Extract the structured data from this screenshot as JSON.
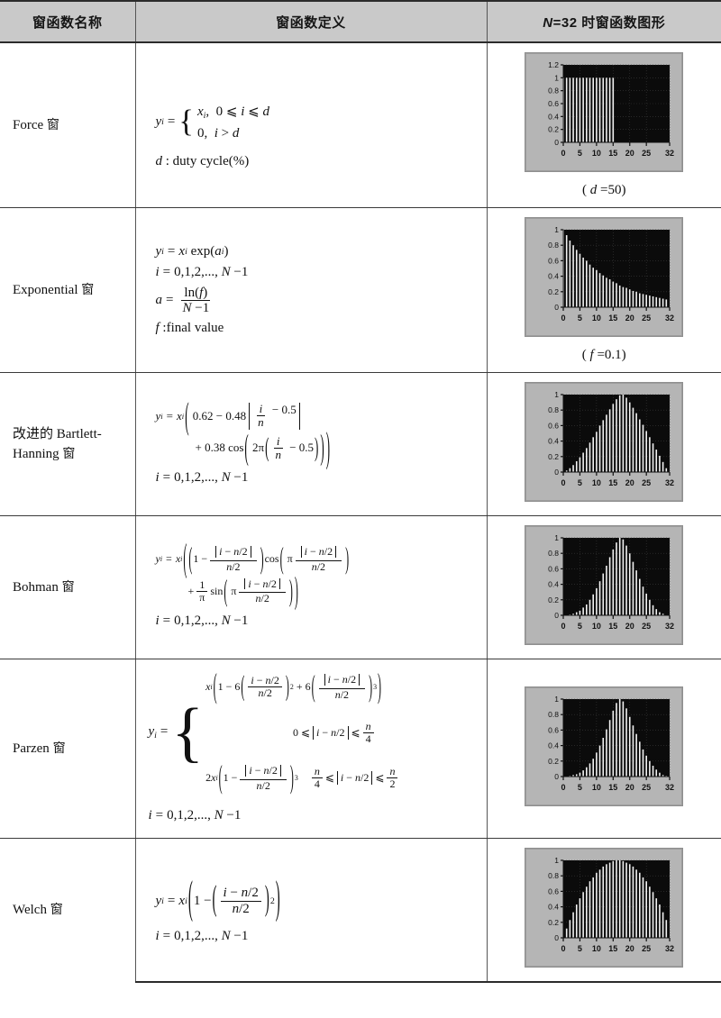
{
  "table": {
    "headers": {
      "name": "窗函数名称",
      "definition": "窗函数定义",
      "plot_prefix": "N",
      "plot_rest": "=32 时窗函数图形"
    },
    "rows": [
      {
        "id": "force",
        "name_en": "Force",
        "name_cn": "窗",
        "caption_open": "(",
        "caption_var": "d",
        "caption_val": "=50)",
        "formula_lines": [
          "y_i = { x_i, 0 ≤ i ≤ d ; 0, i > d }",
          "d : duty cycle(%)"
        ],
        "tokens": {
          "y": "y",
          "eq": "=",
          "x": "x",
          "case1_cond": "0 ≤ i ≤ d",
          "case1_val": "x",
          "case2_val": "0,",
          "case2_cond": "i > d",
          "note": "d : duty cycle(%)",
          "note_var": "d",
          "note_rest": ": duty cycle(%)"
        }
      },
      {
        "id": "exponential",
        "name_en": "Exponential",
        "name_cn": "窗",
        "caption_open": "(",
        "caption_var": "f",
        "caption_val": "=0.1)",
        "tokens": {
          "line1": "y_i = x_i exp(a_i)",
          "line2": "i = 0,1,2,..., N −1",
          "line3_a": "a",
          "line3_num": "ln(f)",
          "line3_den": "N −1",
          "line4_var": "f",
          "line4_rest": ":final value"
        }
      },
      {
        "id": "bartlett-hanning",
        "name_en": "改进的 Bartlett-Hanning",
        "name_cn": "窗",
        "caption_open": "",
        "caption_var": "",
        "caption_val": "",
        "tokens": {
          "c1": "0.62",
          "c2": "0.48",
          "c3": "0.5",
          "c4": "0.38",
          "c5": "2π",
          "c6": "0.5",
          "index": "i = 0,1,2,..., N −1"
        }
      },
      {
        "id": "bohman",
        "name_en": "Bohman",
        "name_cn": "窗",
        "caption_open": "",
        "caption_var": "",
        "caption_val": "",
        "tokens": {
          "one": "1",
          "absnum": "|i − n/2|",
          "den": "n/2",
          "cos": "cos",
          "pi": "π",
          "sin": "sin",
          "index": "i = 0,1,2,..., N −1"
        }
      },
      {
        "id": "parzen",
        "name_en": "Parzen",
        "name_cn": "窗",
        "caption_open": "",
        "caption_var": "",
        "caption_val": "",
        "tokens": {
          "coef6a": "6",
          "coef6b": "6",
          "pow2": "2",
          "pow3": "3",
          "cond1": "0 ≤ |i − n/2| ≤ n/4",
          "coef2": "2",
          "cond2": "n/4 ≤ |i − n/2| ≤ n/2",
          "index": "i = 0,1,2,..., N −1"
        }
      },
      {
        "id": "welch",
        "name_en": "Welch",
        "name_cn": "窗",
        "caption_open": "",
        "caption_var": "",
        "caption_val": "",
        "tokens": {
          "one": "1",
          "num": "i − n/2",
          "den": "n/2",
          "pow2": "2",
          "index": "i = 0,1,2,..., N −1"
        }
      }
    ]
  },
  "chart_data": [
    {
      "type": "bar",
      "id": "force-plot",
      "title": "",
      "xlabel": "",
      "ylabel": "",
      "xticks": [
        0,
        5,
        10,
        15,
        20,
        25,
        32
      ],
      "yticks": [
        "0",
        "0.2",
        "0.4",
        "0.6",
        "0.8",
        "1",
        "1.2"
      ],
      "ylim": [
        0,
        1.2
      ],
      "xlim": [
        0,
        32
      ],
      "x": [
        0,
        1,
        2,
        3,
        4,
        5,
        6,
        7,
        8,
        9,
        10,
        11,
        12,
        13,
        14,
        15,
        16,
        17,
        18,
        19,
        20,
        21,
        22,
        23,
        24,
        25,
        26,
        27,
        28,
        29,
        30,
        31
      ],
      "values": [
        1,
        1,
        1,
        1,
        1,
        1,
        1,
        1,
        1,
        1,
        1,
        1,
        1,
        1,
        1,
        1,
        0,
        0,
        0,
        0,
        0,
        0,
        0,
        0,
        0,
        0,
        0,
        0,
        0,
        0,
        0,
        0
      ],
      "bg": "#0b0b0b",
      "bar_color": "#f2f2f2",
      "panel": "#b5b5b5"
    },
    {
      "type": "bar",
      "id": "exponential-plot",
      "title": "",
      "xticks": [
        0,
        5,
        10,
        15,
        20,
        25,
        32
      ],
      "yticks": [
        "0",
        "0.2",
        "0.4",
        "0.6",
        "0.8",
        "1"
      ],
      "ylim": [
        0,
        1
      ],
      "xlim": [
        0,
        32
      ],
      "x": [
        0,
        1,
        2,
        3,
        4,
        5,
        6,
        7,
        8,
        9,
        10,
        11,
        12,
        13,
        14,
        15,
        16,
        17,
        18,
        19,
        20,
        21,
        22,
        23,
        24,
        25,
        26,
        27,
        28,
        29,
        30,
        31
      ],
      "values": [
        1.0,
        0.93,
        0.86,
        0.8,
        0.74,
        0.69,
        0.64,
        0.6,
        0.55,
        0.51,
        0.48,
        0.44,
        0.41,
        0.38,
        0.36,
        0.33,
        0.31,
        0.28,
        0.26,
        0.25,
        0.23,
        0.21,
        0.2,
        0.18,
        0.17,
        0.16,
        0.15,
        0.14,
        0.13,
        0.12,
        0.11,
        0.1
      ],
      "bg": "#0b0b0b",
      "bar_color": "#f2f2f2",
      "panel": "#b5b5b5"
    },
    {
      "type": "bar",
      "id": "bartlett-hanning-plot",
      "title": "",
      "xticks": [
        0,
        5,
        10,
        15,
        20,
        25,
        32
      ],
      "yticks": [
        "0",
        "0.2",
        "0.4",
        "0.6",
        "0.8",
        "1"
      ],
      "ylim": [
        0,
        1
      ],
      "xlim": [
        0,
        32
      ],
      "x": [
        0,
        1,
        2,
        3,
        4,
        5,
        6,
        7,
        8,
        9,
        10,
        11,
        12,
        13,
        14,
        15,
        16,
        17,
        18,
        19,
        20,
        21,
        22,
        23,
        24,
        25,
        26,
        27,
        28,
        29,
        30,
        31
      ],
      "values": [
        0.0,
        0.02,
        0.05,
        0.09,
        0.14,
        0.19,
        0.25,
        0.31,
        0.38,
        0.45,
        0.52,
        0.6,
        0.67,
        0.74,
        0.81,
        0.88,
        0.94,
        0.99,
        1.0,
        0.96,
        0.9,
        0.83,
        0.76,
        0.68,
        0.61,
        0.53,
        0.45,
        0.37,
        0.29,
        0.21,
        0.13,
        0.05
      ],
      "bg": "#0b0b0b",
      "bar_color": "#f2f2f2",
      "panel": "#b5b5b5"
    },
    {
      "type": "bar",
      "id": "bohman-plot",
      "title": "",
      "xticks": [
        0,
        5,
        10,
        15,
        20,
        25,
        32
      ],
      "yticks": [
        "0",
        "0.2",
        "0.4",
        "0.6",
        "0.8",
        "1"
      ],
      "ylim": [
        0,
        1
      ],
      "xlim": [
        0,
        32
      ],
      "x": [
        0,
        1,
        2,
        3,
        4,
        5,
        6,
        7,
        8,
        9,
        10,
        11,
        12,
        13,
        14,
        15,
        16,
        17,
        18,
        19,
        20,
        21,
        22,
        23,
        24,
        25,
        26,
        27,
        28,
        29,
        30,
        31
      ],
      "values": [
        0.0,
        0.0,
        0.01,
        0.02,
        0.04,
        0.06,
        0.1,
        0.14,
        0.2,
        0.27,
        0.35,
        0.44,
        0.54,
        0.64,
        0.75,
        0.85,
        0.94,
        1.0,
        0.98,
        0.9,
        0.8,
        0.69,
        0.58,
        0.47,
        0.37,
        0.28,
        0.2,
        0.13,
        0.08,
        0.04,
        0.02,
        0.0
      ],
      "bg": "#0b0b0b",
      "bar_color": "#f2f2f2",
      "panel": "#b5b5b5"
    },
    {
      "type": "bar",
      "id": "parzen-plot",
      "title": "",
      "xticks": [
        0,
        5,
        10,
        15,
        20,
        25,
        32
      ],
      "yticks": [
        "0",
        "0.2",
        "0.4",
        "0.6",
        "0.8",
        "1"
      ],
      "ylim": [
        0,
        1
      ],
      "xlim": [
        0,
        32
      ],
      "x": [
        0,
        1,
        2,
        3,
        4,
        5,
        6,
        7,
        8,
        9,
        10,
        11,
        12,
        13,
        14,
        15,
        16,
        17,
        18,
        19,
        20,
        21,
        22,
        23,
        24,
        25,
        26,
        27,
        28,
        29,
        30,
        31
      ],
      "values": [
        0.0,
        0.0,
        0.01,
        0.02,
        0.03,
        0.05,
        0.08,
        0.12,
        0.17,
        0.23,
        0.31,
        0.4,
        0.5,
        0.61,
        0.73,
        0.85,
        0.95,
        1.0,
        0.97,
        0.88,
        0.77,
        0.66,
        0.55,
        0.45,
        0.35,
        0.27,
        0.2,
        0.14,
        0.09,
        0.05,
        0.02,
        0.01
      ],
      "bg": "#0b0b0b",
      "bar_color": "#f2f2f2",
      "panel": "#b5b5b5"
    },
    {
      "type": "bar",
      "id": "welch-plot",
      "title": "",
      "xticks": [
        0,
        5,
        10,
        15,
        20,
        25,
        32
      ],
      "yticks": [
        "0",
        "0.2",
        "0.4",
        "0.6",
        "0.8",
        "1"
      ],
      "ylim": [
        0,
        1
      ],
      "xlim": [
        0,
        32
      ],
      "x": [
        0,
        1,
        2,
        3,
        4,
        5,
        6,
        7,
        8,
        9,
        10,
        11,
        12,
        13,
        14,
        15,
        16,
        17,
        18,
        19,
        20,
        21,
        22,
        23,
        24,
        25,
        26,
        27,
        28,
        29,
        30,
        31
      ],
      "values": [
        0.0,
        0.12,
        0.23,
        0.33,
        0.43,
        0.51,
        0.59,
        0.66,
        0.73,
        0.78,
        0.84,
        0.88,
        0.92,
        0.95,
        0.97,
        0.99,
        1.0,
        1.0,
        0.99,
        0.97,
        0.95,
        0.92,
        0.88,
        0.84,
        0.78,
        0.73,
        0.66,
        0.59,
        0.51,
        0.43,
        0.33,
        0.23
      ],
      "bg": "#0b0b0b",
      "bar_color": "#f2f2f2",
      "panel": "#b5b5b5"
    }
  ]
}
